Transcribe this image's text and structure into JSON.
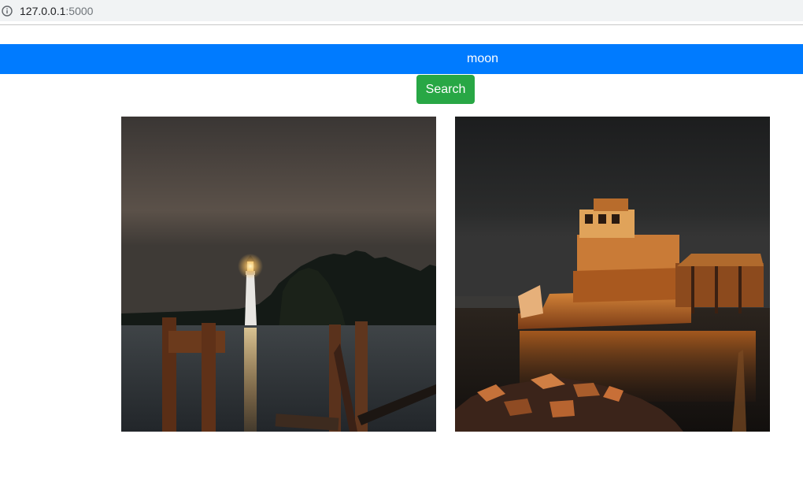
{
  "browser": {
    "url_host": "127.0.0.1",
    "url_port": ":5000",
    "info_icon": "info-icon"
  },
  "search": {
    "value": "moon",
    "button_label": "Search",
    "bar_color": "#007bff",
    "button_color": "#28a745"
  },
  "results": [
    {
      "subject": "lighthouse at night"
    },
    {
      "subject": "rusted ship at night"
    }
  ]
}
